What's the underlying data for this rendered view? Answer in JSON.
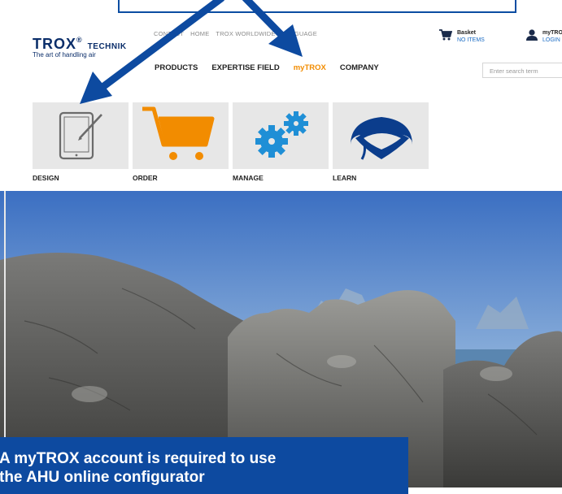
{
  "header": {
    "logo": {
      "brand": "TROX",
      "sub": "TECHNIK",
      "tagline": "The art of handling air"
    },
    "utility_nav": [
      "CONTACT",
      "HOME",
      "TROX WORLDWIDE",
      "LANGUAGE"
    ],
    "main_nav": [
      {
        "label": "PRODUCTS",
        "active": false
      },
      {
        "label": "EXPERTISE FIELD",
        "active": false
      },
      {
        "label": "myTROX",
        "active": true
      },
      {
        "label": "COMPANY",
        "active": false
      }
    ],
    "basket": {
      "label": "Basket",
      "status": "NO ITEMS"
    },
    "account": {
      "label": "myTROX",
      "action": "LOGIN"
    },
    "search": {
      "placeholder": "Enter search term"
    }
  },
  "tiles": [
    {
      "label": "DESIGN",
      "icon": "tablet-pen-icon"
    },
    {
      "label": "ORDER",
      "icon": "shopping-cart-icon"
    },
    {
      "label": "MANAGE",
      "icon": "gears-icon"
    },
    {
      "label": "LEARN",
      "icon": "graduation-cap-icon"
    }
  ],
  "notice": {
    "line1": "A myTROX account is required to use",
    "line2": "the AHU online configurator"
  },
  "colors": {
    "brand_blue": "#0b2e6a",
    "accent_orange": "#f28c00",
    "link_blue": "#1a6bc4",
    "gear_blue": "#1f8fd6",
    "annotation_blue": "#0d4aa0"
  }
}
